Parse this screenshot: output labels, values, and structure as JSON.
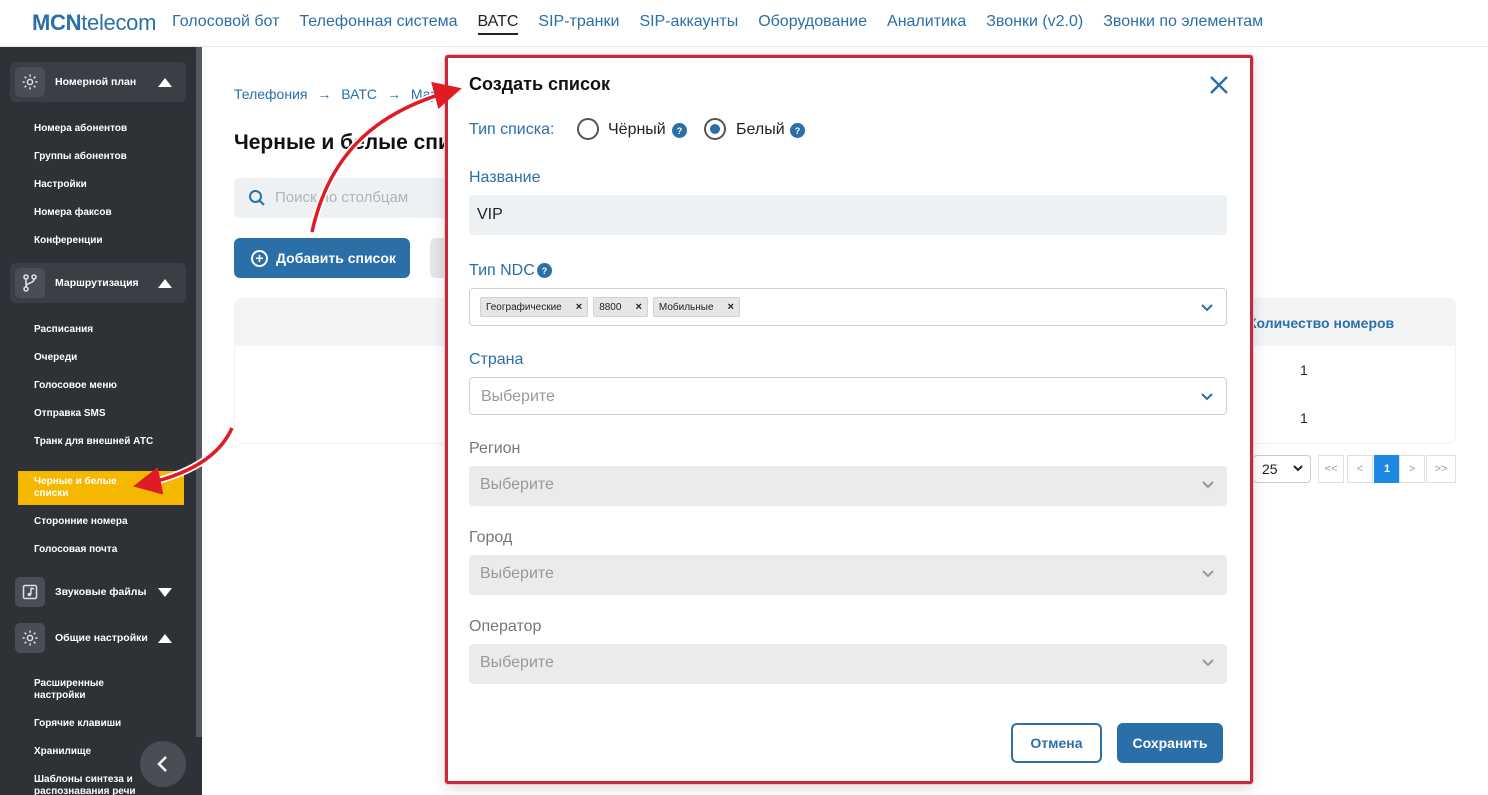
{
  "app": {
    "logo_bold": "MCN",
    "logo_rest": "telecom"
  },
  "topnav": [
    {
      "label": "Голосовой бот",
      "active": false
    },
    {
      "label": "Телефонная система",
      "active": false
    },
    {
      "label": "ВАТС",
      "active": true
    },
    {
      "label": "SIP-транки",
      "active": false
    },
    {
      "label": "SIP-аккаунты",
      "active": false
    },
    {
      "label": "Оборудование",
      "active": false
    },
    {
      "label": "Аналитика",
      "active": false
    },
    {
      "label": "Звонки (v2.0)",
      "active": false
    },
    {
      "label": "Звонки по элементам",
      "active": false
    }
  ],
  "sidebar": {
    "sections": [
      {
        "label": "Номерной план",
        "icon": "gear-icon",
        "expanded": true
      },
      {
        "label": "Маршрутизация",
        "icon": "branch-icon",
        "expanded": true
      },
      {
        "label": "Звуковые файлы",
        "icon": "music-file-icon",
        "expanded": false
      },
      {
        "label": "Общие настройки",
        "icon": "gear-icon",
        "expanded": true
      }
    ],
    "items": [
      "Номера абонентов",
      "Группы абонентов",
      "Настройки",
      "Номера факсов",
      "Конференции",
      "Расписания",
      "Очереди",
      "Голосовое меню",
      "Отправка SMS",
      "Транк для внешней АТС",
      "Черные и белые списки",
      "Сторонние номера",
      "Голосовая почта",
      "Расширенные настройки",
      "Горячие клавиши",
      "Хранилище",
      "Шаблоны синтеза и распознавания речи"
    ],
    "active_item": "Черные и белые списки"
  },
  "main": {
    "breadcrumb": [
      "Телефония",
      "ВАТС",
      "Марш"
    ],
    "title": "Черные и белые списки",
    "search_placeholder": "Поиск по столбцам",
    "add_button": "Добавить список",
    "table": {
      "count_header": "Количество номеров",
      "rows": [
        "1",
        "1"
      ]
    },
    "pagination": {
      "per_page": "25",
      "first": "<<",
      "prev": "<",
      "current": "1",
      "next": ">",
      "last": ">>"
    }
  },
  "modal": {
    "title": "Создать список",
    "list_type_label": "Тип списка:",
    "options": [
      {
        "label": "Чёрный",
        "selected": false
      },
      {
        "label": "Белый",
        "selected": true
      }
    ],
    "help": "?",
    "name_label": "Название",
    "name_value": "VIP",
    "ndc_label": "Тип NDC",
    "ndc_chips": [
      "Географические",
      "8800",
      "Мобильные"
    ],
    "country_label": "Страна",
    "region_label": "Регион",
    "city_label": "Город",
    "operator_label": "Оператор",
    "select_placeholder": "Выберите",
    "cancel": "Отмена",
    "save": "Сохранить"
  },
  "colors": {
    "accent": "#2a6fa8",
    "sidebar": "#2e3136",
    "active_item": "#f5b800",
    "highlight": "#c8283c"
  }
}
